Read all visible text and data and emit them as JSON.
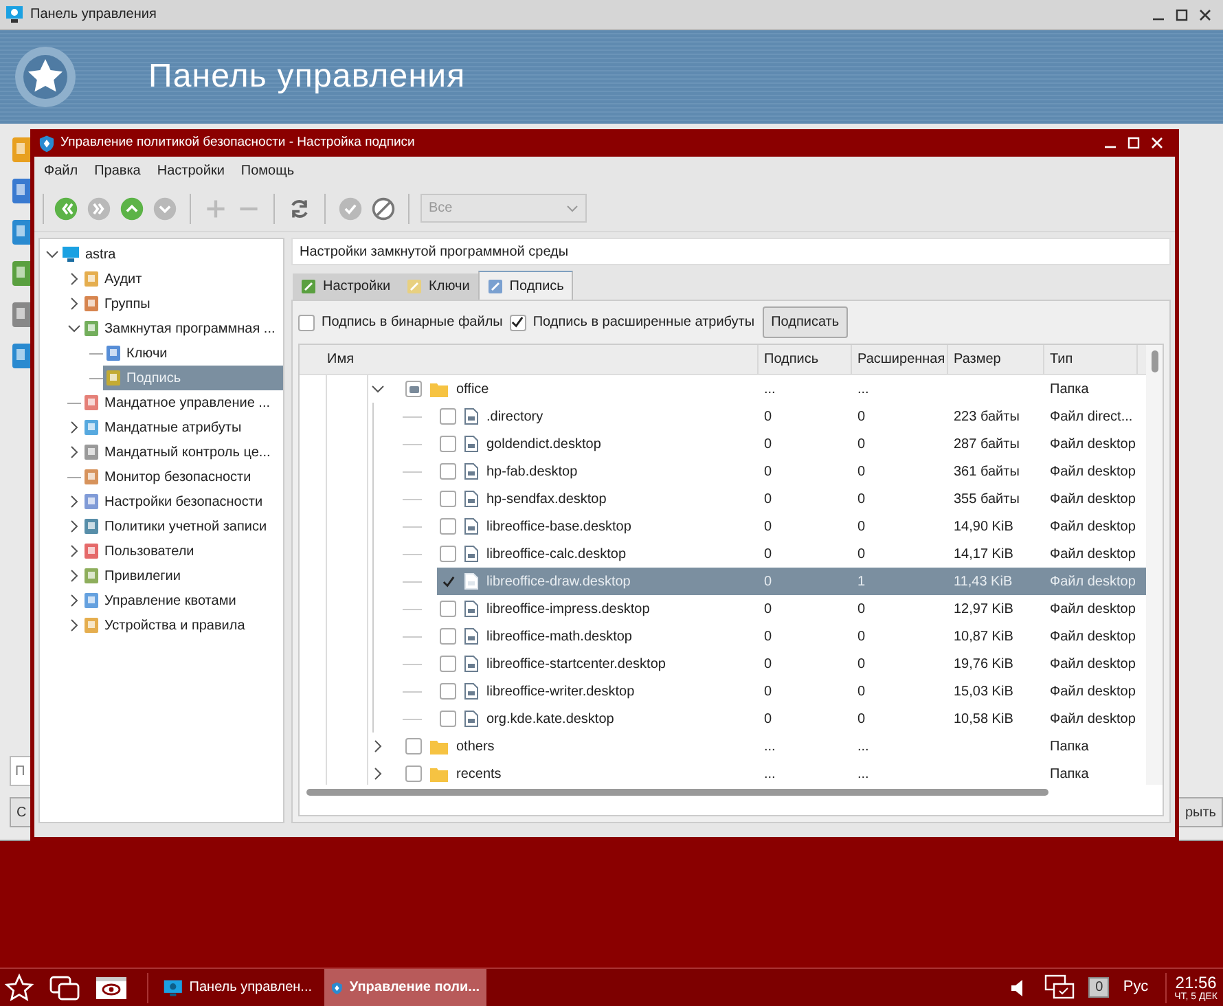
{
  "window": {
    "title": "Панель управления"
  },
  "banner": {
    "title": "Панель управления"
  },
  "background_controls": {
    "field_value": "П",
    "left_button": "С",
    "right_button": "рыть"
  },
  "dialog": {
    "title": "Управление политикой безопасности - Настройка подписи",
    "menu": [
      "Файл",
      "Правка",
      "Настройки",
      "Помощь"
    ],
    "toolbar": [
      {
        "kind": "first",
        "enabled": true
      },
      {
        "kind": "last",
        "enabled": false
      },
      {
        "kind": "up",
        "enabled": true
      },
      {
        "kind": "down",
        "enabled": false
      },
      {
        "kind": "separator"
      },
      {
        "kind": "add",
        "enabled": false
      },
      {
        "kind": "remove",
        "enabled": false
      },
      {
        "kind": "separator"
      },
      {
        "kind": "refresh",
        "enabled": true
      },
      {
        "kind": "separator"
      },
      {
        "kind": "apply",
        "enabled": false
      },
      {
        "kind": "cancel",
        "enabled": true
      },
      {
        "kind": "separator"
      }
    ],
    "filter": {
      "value": "Все",
      "disabled": true
    },
    "tree": [
      {
        "label": "astra",
        "kind": "computer",
        "expanded": true,
        "selected": false,
        "children": [
          {
            "label": "Аудит",
            "expanded": false,
            "selected": false
          },
          {
            "label": "Группы",
            "expanded": false,
            "selected": false
          },
          {
            "label": "Замкнутая программная ...",
            "expanded": true,
            "selected": false,
            "children": [
              {
                "label": "Ключи",
                "selected": false
              },
              {
                "label": "Подпись",
                "selected": true
              }
            ]
          },
          {
            "label": "Мандатное управление ...",
            "selected": false
          },
          {
            "label": "Мандатные атрибуты",
            "expanded": false,
            "selected": false
          },
          {
            "label": "Мандатный контроль це...",
            "expanded": false,
            "selected": false
          },
          {
            "label": "Монитор безопасности",
            "selected": false
          },
          {
            "label": "Настройки безопасности",
            "expanded": false,
            "selected": false
          },
          {
            "label": "Политики учетной записи",
            "expanded": false,
            "selected": false
          },
          {
            "label": "Пользователи",
            "expanded": false,
            "selected": false
          },
          {
            "label": "Привилегии",
            "expanded": false,
            "selected": false
          },
          {
            "label": "Управление квотами",
            "expanded": false,
            "selected": false
          },
          {
            "label": "Устройства и правила",
            "expanded": false,
            "selected": false
          }
        ]
      }
    ],
    "section_title": "Настройки замкнутой программной среды",
    "tabs": [
      {
        "label": "Настройки",
        "selected": false
      },
      {
        "label": "Ключи",
        "selected": false
      },
      {
        "label": "Подпись",
        "selected": true
      }
    ],
    "options": [
      {
        "label": "Подпись в бинарные файлы",
        "checked": false
      },
      {
        "label": "Подпись в расширенные атрибуты",
        "checked": true
      }
    ],
    "sign_button": "Подписать",
    "table": {
      "columns": [
        "Имя",
        "Подпись",
        "Расширенная",
        "Размер",
        "Тип"
      ],
      "rows": [
        {
          "name": "office",
          "expanded": true,
          "partial": true,
          "selected": false,
          "signature": "...",
          "extended": "...",
          "type": "Папка",
          "children": [
            {
              "name": ".directory",
              "checked": false,
              "selected": false,
              "signature": "0",
              "extended": "0",
              "size": "223 байты",
              "type": "Файл direct..."
            },
            {
              "name": "goldendict.desktop",
              "checked": false,
              "selected": false,
              "signature": "0",
              "extended": "0",
              "size": "287 байты",
              "type": "Файл desktop"
            },
            {
              "name": "hp-fab.desktop",
              "checked": false,
              "selected": false,
              "signature": "0",
              "extended": "0",
              "size": "361 байты",
              "type": "Файл desktop"
            },
            {
              "name": "hp-sendfax.desktop",
              "checked": false,
              "selected": false,
              "signature": "0",
              "extended": "0",
              "size": "355 байты",
              "type": "Файл desktop"
            },
            {
              "name": "libreoffice-base.desktop",
              "checked": false,
              "selected": false,
              "signature": "0",
              "extended": "0",
              "size": "14,90 KiB",
              "type": "Файл desktop"
            },
            {
              "name": "libreoffice-calc.desktop",
              "checked": false,
              "selected": false,
              "signature": "0",
              "extended": "0",
              "size": "14,17 KiB",
              "type": "Файл desktop"
            },
            {
              "name": "libreoffice-draw.desktop",
              "checked": true,
              "selected": true,
              "signature": "0",
              "extended": "1",
              "size": "11,43 KiB",
              "type": "Файл desktop"
            },
            {
              "name": "libreoffice-impress.desktop",
              "checked": false,
              "selected": false,
              "signature": "0",
              "extended": "0",
              "size": "12,97 KiB",
              "type": "Файл desktop"
            },
            {
              "name": "libreoffice-math.desktop",
              "checked": false,
              "selected": false,
              "signature": "0",
              "extended": "0",
              "size": "10,87 KiB",
              "type": "Файл desktop"
            },
            {
              "name": "libreoffice-startcenter.desktop",
              "checked": false,
              "selected": false,
              "signature": "0",
              "extended": "0",
              "size": "19,76 KiB",
              "type": "Файл desktop"
            },
            {
              "name": "libreoffice-writer.desktop",
              "checked": false,
              "selected": false,
              "signature": "0",
              "extended": "0",
              "size": "15,03 KiB",
              "type": "Файл desktop"
            },
            {
              "name": "org.kde.kate.desktop",
              "checked": false,
              "selected": false,
              "signature": "0",
              "extended": "0",
              "size": "10,58 KiB",
              "type": "Файл desktop"
            }
          ]
        },
        {
          "name": "others",
          "expanded": false,
          "checked": false,
          "partial": false,
          "selected": false,
          "signature": "...",
          "extended": "...",
          "type": "Папка"
        },
        {
          "name": "recents",
          "expanded": false,
          "checked": false,
          "partial": false,
          "selected": false,
          "signature": "...",
          "extended": "...",
          "type": "Папка"
        }
      ]
    }
  },
  "taskbar": {
    "tasks": [
      {
        "label": "Панель управлен...",
        "kind": "panel",
        "selected": false
      },
      {
        "label": "Управление поли...",
        "kind": "shield",
        "selected": true
      }
    ],
    "keyboard_indicator": "0",
    "language": "Рус",
    "time": "21:56",
    "date": "ЧТ, 5 ДЕК"
  }
}
